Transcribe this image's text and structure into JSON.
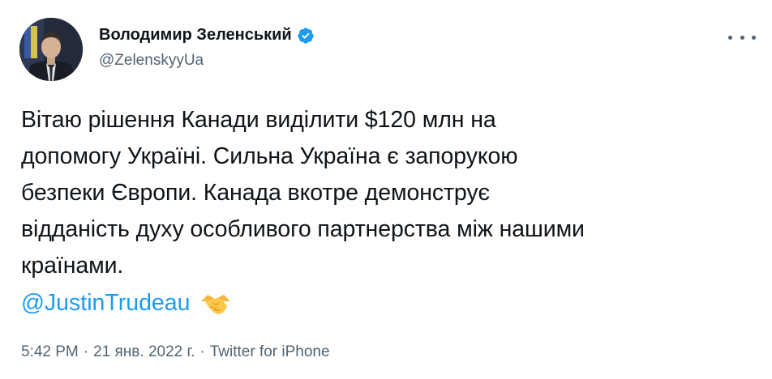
{
  "author": {
    "display_name": "Володимир Зеленський",
    "handle": "@ZelenskyyUa",
    "verified_icon": "verified-badge-icon",
    "avatar_icon": "profile-photo"
  },
  "more_icon": "more-options-icon",
  "tweet": {
    "lines": [
      "Вітаю рішення Канади виділити $120 млн на",
      "допомогу Україні. Сильна Україна є запорукою",
      "безпеки Європи. Канада вкотре демонструє",
      "відданість духу особливого партнерства між нашими",
      "країнами."
    ],
    "mention": "@JustinTrudeau",
    "emoji_icon": "handshake-emoji-icon"
  },
  "meta": {
    "time": "5:42 PM",
    "sep1": "·",
    "date": "21 янв. 2022 г.",
    "sep2": "·",
    "source": "Twitter for iPhone"
  },
  "colors": {
    "link": "#1d9bf0",
    "secondary_text": "#536471",
    "primary_text": "#0f1419"
  }
}
